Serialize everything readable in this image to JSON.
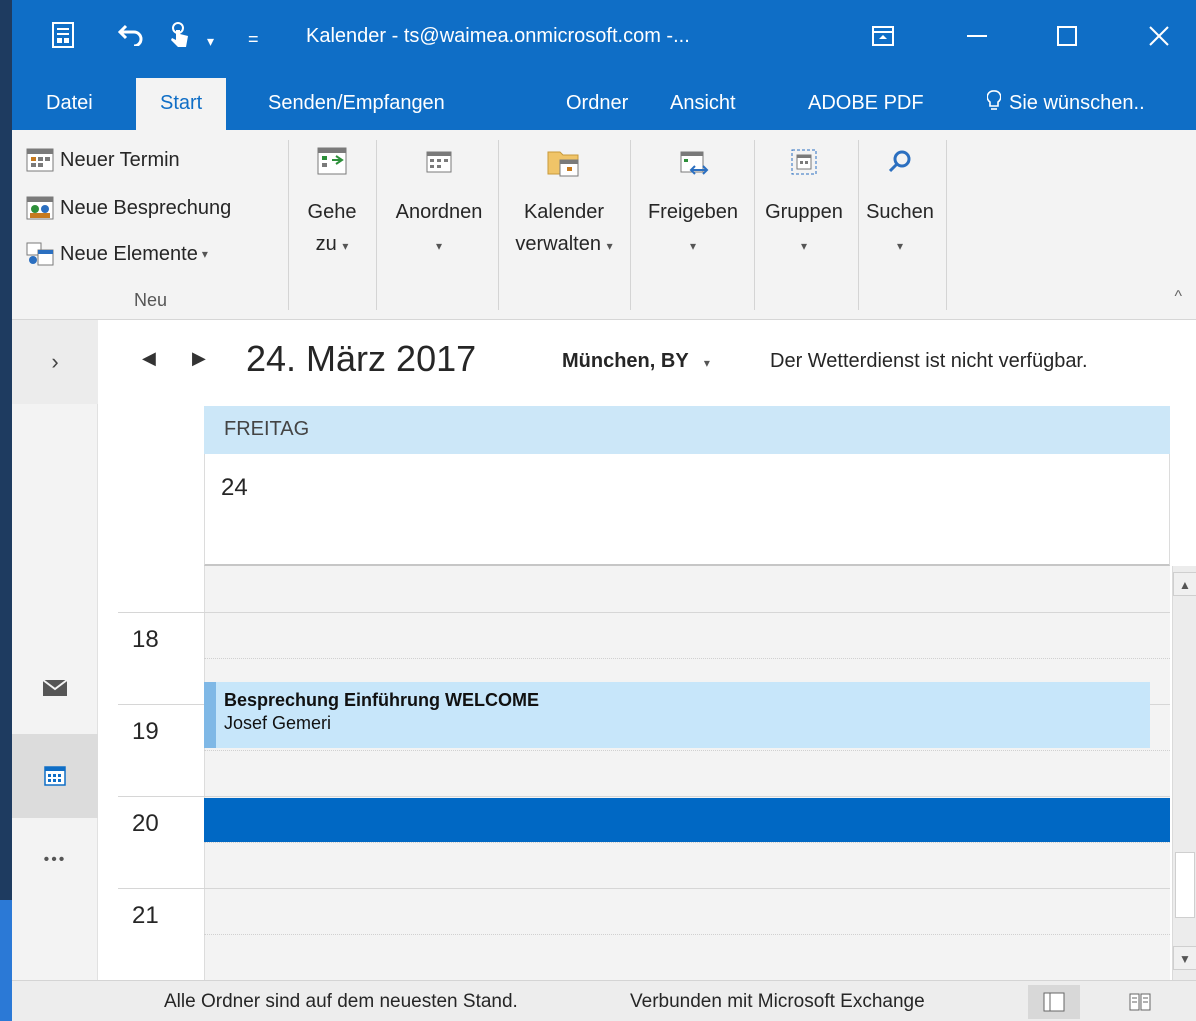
{
  "window": {
    "title": "Kalender - ts@waimea.onmicrosoft.com -...",
    "colors": {
      "brand": "#0f6ec6",
      "ribbon": "#f3f3f3",
      "day_header": "#cce7f8",
      "event": "#c7e6fa",
      "now_bar": "#0068c4"
    }
  },
  "quick_access": {
    "icons": [
      "send-receive-icon",
      "undo-icon",
      "touch-mode-icon",
      "customize-icon"
    ],
    "caret": "▾",
    "overflow": "="
  },
  "tabs": [
    {
      "label": "Datei"
    },
    {
      "label": "Start"
    },
    {
      "label": "Senden/Empfangen"
    },
    {
      "label": "Ordner"
    },
    {
      "label": "Ansicht"
    },
    {
      "label": "ADOBE PDF"
    }
  ],
  "tell_me": "Sie wünschen..",
  "ribbon": {
    "group_neu": {
      "label": "Neu",
      "new_appointment": "Neuer Termin",
      "new_meeting": "Neue Besprechung",
      "new_items": "Neue Elemente",
      "dropdown_caret": "▾"
    },
    "goto": {
      "line1": "Gehe",
      "line2": "zu"
    },
    "arrange": {
      "line1": "Anordnen"
    },
    "manage": {
      "line1": "Kalender",
      "line2": "verwalten"
    },
    "share": {
      "line1": "Freigeben"
    },
    "groups": {
      "line1": "Gruppen"
    },
    "search": {
      "line1": "Suchen"
    },
    "caret": "▾",
    "collapse": "^"
  },
  "calendar": {
    "prev": "◀",
    "next": "▶",
    "date": "24. März 2017",
    "location": "München, BY",
    "location_caret": "▾",
    "weather": "Der Wetterdienst ist nicht verfügbar.",
    "weekday": "FREITAG",
    "day_number": "24",
    "hours": [
      "18",
      "19",
      "20",
      "21"
    ],
    "event": {
      "title": "Besprechung Einführung WELCOME",
      "organizer": "Josef Gemeri"
    }
  },
  "nav": {
    "expand": "›",
    "more": "•••"
  },
  "scrollbar": {
    "up": "▲",
    "down": "▼"
  },
  "status": {
    "folders": "Alle Ordner sind auf dem neuesten Stand.",
    "connection": "Verbunden mit Microsoft Exchange"
  }
}
